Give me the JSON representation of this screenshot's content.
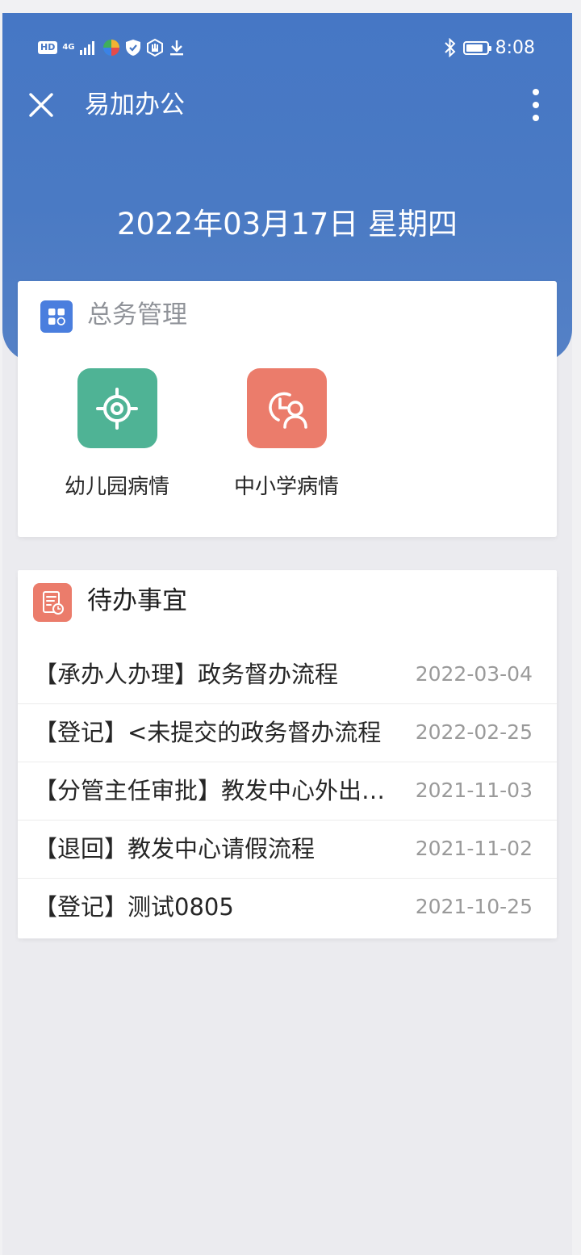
{
  "status_bar": {
    "badges": [
      "HD",
      "4G"
    ],
    "time": "8:08",
    "battery_level": 0.85,
    "icons": [
      "signal-icon",
      "app-icon",
      "shield-icon",
      "hand-icon",
      "download-icon",
      "bluetooth-icon",
      "battery-icon"
    ]
  },
  "nav": {
    "title": "易加办公",
    "close_icon": "close-icon",
    "more_icon": "more-vertical-icon"
  },
  "header": {
    "date": "2022年03月17日 星期四"
  },
  "general_affairs": {
    "title": "总务管理",
    "icon": "grid-icon",
    "apps": [
      {
        "label": "幼儿园病情",
        "icon": "target-icon",
        "color": "#4fb395"
      },
      {
        "label": "中小学病情",
        "icon": "clock-user-icon",
        "color": "#eb7c6b"
      }
    ]
  },
  "todo": {
    "title": "待办事宜",
    "icon": "document-clock-icon",
    "items": [
      {
        "title": "【承办人办理】政务督办流程",
        "date": "2022-03-04"
      },
      {
        "title": "【登记】<未提交的政务督办流程",
        "date": "2022-02-25"
      },
      {
        "title": "【分管主任审批】教发中心外出流程",
        "date": "2021-11-03"
      },
      {
        "title": "【退回】教发中心请假流程",
        "date": "2021-11-02"
      },
      {
        "title": "【登记】测试0805",
        "date": "2021-10-25"
      }
    ]
  },
  "colors": {
    "header_blue": "#4677c5",
    "accent_blue": "#4a7ede",
    "green": "#4fb395",
    "salmon": "#eb7c6b",
    "page_bg": "#ebebef"
  }
}
